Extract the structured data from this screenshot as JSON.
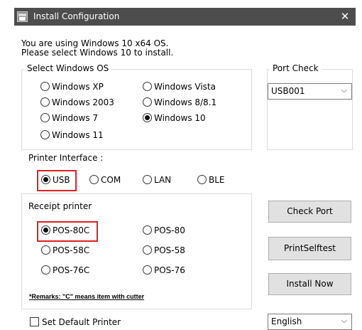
{
  "window": {
    "title": "Install Configuration",
    "close_glyph": "✕"
  },
  "intro": {
    "line1": "You are using Windows 10 x64 OS.",
    "line2": "Please select Windows 10 to install."
  },
  "os_group": {
    "title": "Select Windows OS",
    "options": [
      {
        "label": "Windows XP",
        "checked": false
      },
      {
        "label": "Windows Vista",
        "checked": false
      },
      {
        "label": "Windows 2003",
        "checked": false
      },
      {
        "label": "Windows 8/8.1",
        "checked": false
      },
      {
        "label": "Windows 7",
        "checked": false
      },
      {
        "label": "Windows 10",
        "checked": true
      },
      {
        "label": "Windows 11",
        "checked": false
      }
    ]
  },
  "port_check": {
    "title": "Port Check",
    "selected": "USB001"
  },
  "printer_interface": {
    "label": "Printer Interface :",
    "options": [
      {
        "label": "USB",
        "checked": true
      },
      {
        "label": "COM",
        "checked": false
      },
      {
        "label": "LAN",
        "checked": false
      },
      {
        "label": "BLE",
        "checked": false
      }
    ]
  },
  "receipt_printer": {
    "title": "Receipt printer",
    "options": [
      {
        "label": "POS-80C",
        "checked": true
      },
      {
        "label": "POS-80",
        "checked": false
      },
      {
        "label": "POS-58C",
        "checked": false
      },
      {
        "label": "POS-58",
        "checked": false
      },
      {
        "label": "POS-76C",
        "checked": false
      },
      {
        "label": "POS-76",
        "checked": false
      }
    ],
    "remarks": "*Remarks: \"C\" means item with cutter"
  },
  "buttons": {
    "check_port": "Check Port",
    "print_selftest": "PrintSelftest",
    "install_now": "Install Now"
  },
  "bottom": {
    "set_default_printer": "Set Default Printer",
    "language": "English"
  },
  "colors": {
    "titlebar": "#4d4d4d",
    "highlight": "#e02020"
  }
}
